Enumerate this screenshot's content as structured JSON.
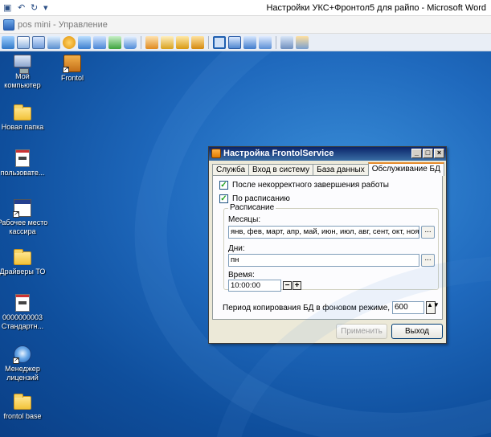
{
  "word": {
    "title": "Настройки УКС+Фронтол5 для райпо  -  Microsoft Word",
    "quick_access": [
      {
        "name": "save-icon",
        "glyph": "▣"
      },
      {
        "name": "undo-icon",
        "glyph": "↶"
      },
      {
        "name": "redo-icon",
        "glyph": "↻"
      },
      {
        "name": "customize-quick-access-icon",
        "glyph": "▾"
      }
    ]
  },
  "vm": {
    "title": "pos mini - Управление"
  },
  "desktop": {
    "icons": [
      {
        "label": "Мой\nкомпьютер",
        "icon": "computer-icon"
      },
      {
        "label": "Frontol",
        "icon": "frontol-icon"
      },
      {
        "label": "Новая папка",
        "icon": "folder-icon"
      },
      {
        "label": "пользовате...",
        "icon": "document-icon"
      },
      {
        "label": "Рабочее место\nкассира",
        "icon": "window-icon"
      },
      {
        "label": "Драйверы ТО",
        "icon": "folder-icon"
      },
      {
        "label": "0000000003\nСтандартн...",
        "icon": "document-icon"
      },
      {
        "label": "Менеджер\nлицензий",
        "icon": "license-manager-icon"
      },
      {
        "label": "frontol base",
        "icon": "folder-icon"
      }
    ]
  },
  "dialog": {
    "title": "Настройка FrontolService",
    "window_buttons": {
      "minimize": "_",
      "maximize": "□",
      "close": "×"
    },
    "tabs": [
      "Служба",
      "Вход в систему",
      "База данных",
      "Обслуживание БД"
    ],
    "active_tab": 3,
    "after_incorrect_shutdown": {
      "label": "После некорректного завершения работы",
      "checked": true,
      "mark": "✓"
    },
    "on_schedule": {
      "label": "По расписанию",
      "checked": true,
      "mark": "✓"
    },
    "schedule": {
      "title": "Расписание",
      "months_label": "Месяцы:",
      "months_value": "янв, фев, март, апр, май, июн, июл, авг, сент, окт, нояб, д",
      "days_label": "Дни:",
      "days_value": "пн",
      "time_label": "Время:",
      "time_value": "10:00:00",
      "browse": "...",
      "minus": "−",
      "plus": "+"
    },
    "period_label": "Период копирования БД в фоновом режиме, сек",
    "period_value": "600",
    "period_spin": "▲▼",
    "apply_button": "Применить",
    "exit_button": "Выход"
  }
}
